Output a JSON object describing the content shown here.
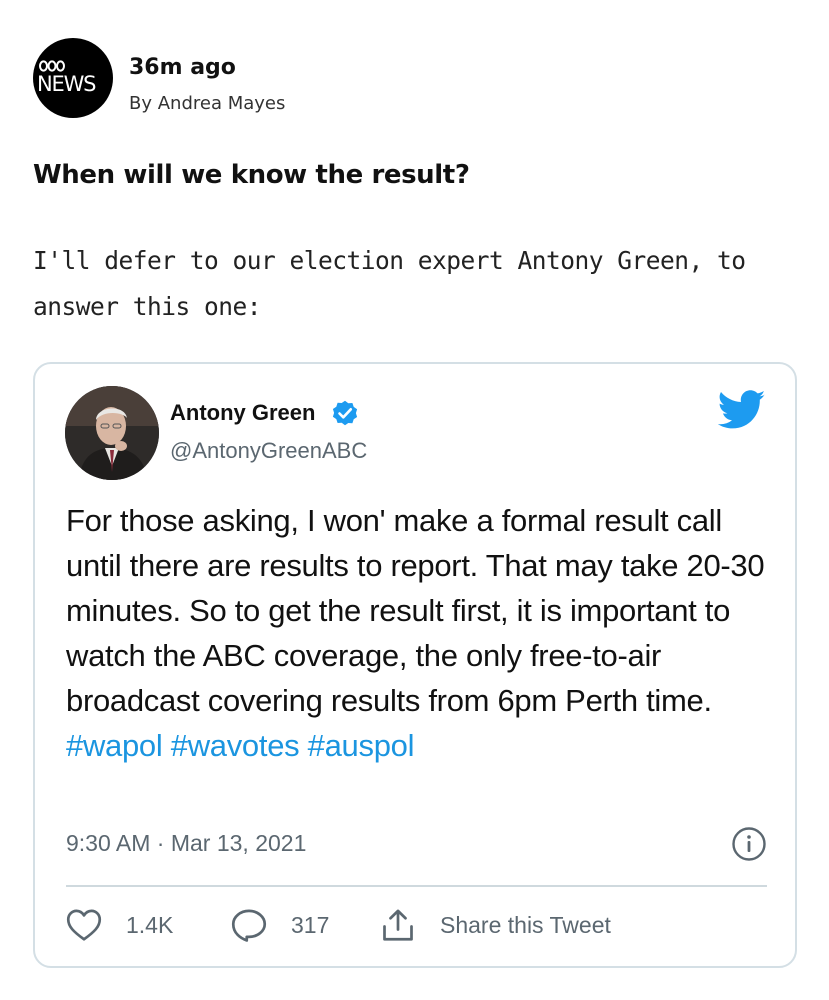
{
  "post": {
    "logo": {
      "line1": "ABC",
      "line2": "NEWS"
    },
    "time": "36m ago",
    "author": "By Andrea Mayes",
    "headline": "When will we know the result?",
    "body": "I'll defer to our election expert Antony Green, to answer this one:"
  },
  "tweet": {
    "name": "Antony Green",
    "handle": "@AntonyGreenABC",
    "text_before": "For those asking, I won' make a formal result call until there are results to report. That may take 20-30 minutes. So to get the result first, it is important to watch the ABC coverage, the only free-to-air broadcast covering results from 6pm Perth time.",
    "hashtags": [
      "#wapol",
      "#wavotes",
      "#auspol"
    ],
    "timestamp": "9:30 AM · Mar 13, 2021",
    "actions": {
      "like_count": "1.4K",
      "reply_count": "317",
      "share_label": "Share this Tweet"
    },
    "icons": [
      "verified-badge-icon",
      "twitter-bird-icon",
      "info-icon",
      "heart-icon",
      "reply-bubble-icon",
      "share-icon"
    ],
    "colors": {
      "link": "#1b95e0",
      "verified": "#1d9bf0",
      "muted": "#5b6770",
      "border": "#d4dfe5"
    }
  }
}
